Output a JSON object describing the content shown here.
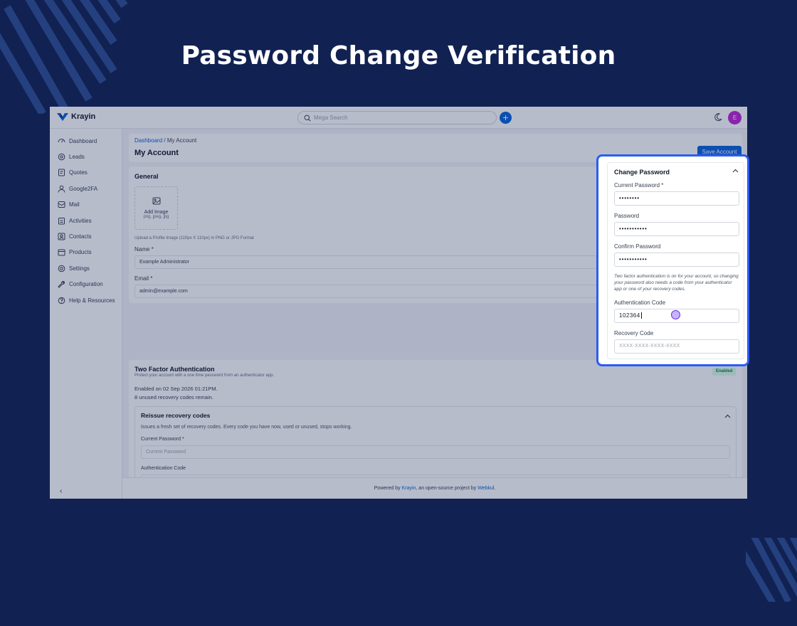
{
  "hero": {
    "title": "Password Change Verification"
  },
  "colors": {
    "background": "#112152",
    "accent": "#0b63d8",
    "highlight": "#2b5cf2",
    "stripes": "#24407f"
  },
  "app": {
    "logo_text": "Krayin",
    "search_placeholder": "Mega Search",
    "avatar_initial": "E",
    "sidebar": [
      {
        "label": "Dashboard",
        "icon": "dashboard-icon"
      },
      {
        "label": "Leads",
        "icon": "leads-icon"
      },
      {
        "label": "Quotes",
        "icon": "quotes-icon"
      },
      {
        "label": "Google2FA",
        "icon": "user-icon"
      },
      {
        "label": "Mail",
        "icon": "mail-icon"
      },
      {
        "label": "Activities",
        "icon": "activities-icon"
      },
      {
        "label": "Contacts",
        "icon": "contacts-icon"
      },
      {
        "label": "Products",
        "icon": "products-icon"
      },
      {
        "label": "Settings",
        "icon": "settings-icon"
      },
      {
        "label": "Configuration",
        "icon": "wrench-icon"
      },
      {
        "label": "Help & Resources",
        "icon": "help-icon"
      }
    ],
    "breadcrumb": {
      "link": "Dashboard",
      "separator": " / ",
      "current": "My Account"
    },
    "page_title": "My Account",
    "save_button": "Save Account",
    "general": {
      "title": "General",
      "add_image": "Add Image",
      "image_types": "png, jpeg, jpg",
      "helper": "Upload a Profile Image (110px X 110px) in PNG or JPG Format",
      "name_label": "Name *",
      "name_value": "Example Administrator",
      "email_label": "Email *",
      "email_value": "admin@example.com"
    },
    "tfa": {
      "title": "Two Factor Authentication",
      "subtitle": "Protect your account with a one time password from an authenticator app.",
      "enabled_on": "Enabled on 02 Sep 2026 01:21PM.",
      "codes_remain": "8 unused recovery codes remain.",
      "badge": "Enabled",
      "reissue_title": "Reissue recovery codes",
      "reissue_desc": "Issues a fresh set of recovery codes. Every code you have now, used or unused, stops working.",
      "current_password_label": "Current Password *",
      "current_password_placeholder": "Current Password",
      "auth_code_label": "Authentication Code"
    },
    "footer": {
      "prefix": "Powered by ",
      "krayin": "Krayin",
      "middle": ", an open-source project by ",
      "webkul": "Webkul",
      "suffix": "."
    }
  },
  "change_password": {
    "title": "Change Password",
    "current_label": "Current Password *",
    "current_value": "••••••••",
    "password_label": "Password",
    "password_value": "•••••••••••",
    "confirm_label": "Confirm Password",
    "confirm_value": "•••••••••••",
    "note": "Two factor authentication is on for your account, so changing your password also needs a code from your authenticator app or one of your recovery codes.",
    "auth_label": "Authentication Code",
    "auth_value": "102364",
    "recovery_label": "Recovery Code",
    "recovery_placeholder": "XXXX-XXXX-XXXX-XXXX"
  }
}
